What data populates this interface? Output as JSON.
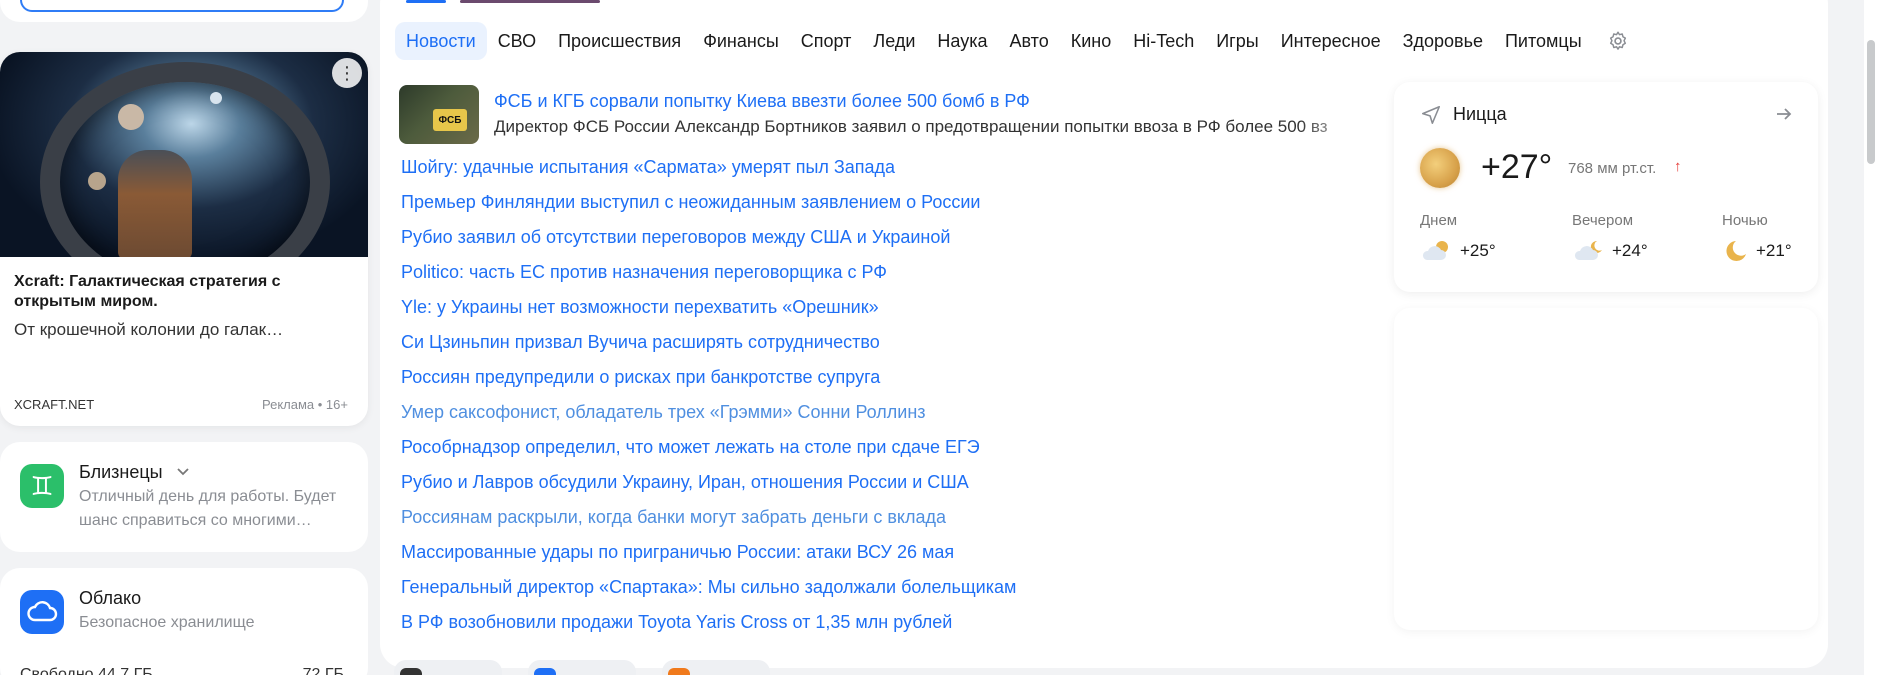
{
  "ad": {
    "menu_glyph": "⋮",
    "title": "Xcraft: Галактическая стратегия с открытым миром.",
    "description": "От крошечной колонии до галак…",
    "domain": "XCRAFT.NET",
    "label": "Реклама • 16+"
  },
  "horoscope": {
    "sign_glyph": "♊",
    "title": "Близнецы",
    "text_line1": "Отличный день для работы. Будет",
    "text_line2": "шанс справиться со многими…"
  },
  "cloud": {
    "title": "Облако",
    "subtitle": "Безопасное хранилище",
    "free": "Свободно 44,7 ГБ",
    "total": "72 ГБ"
  },
  "tabs": [
    {
      "label": "Новости",
      "active": true
    },
    {
      "label": "СВО"
    },
    {
      "label": "Происшествия"
    },
    {
      "label": "Финансы"
    },
    {
      "label": "Спорт"
    },
    {
      "label": "Леди"
    },
    {
      "label": "Наука"
    },
    {
      "label": "Авто"
    },
    {
      "label": "Кино"
    },
    {
      "label": "Hi-Tech"
    },
    {
      "label": "Игры"
    },
    {
      "label": "Интересное"
    },
    {
      "label": "Здоровье"
    },
    {
      "label": "Питомцы"
    }
  ],
  "feature": {
    "thumb_badge": "ФСБ",
    "title": "ФСБ и КГБ сорвали попытку Киева ввезти более 500 бомб в РФ",
    "lead": "Директор ФСБ России Александр Бортников заявил о предотвращении попытки ввоза в РФ более 500 вз"
  },
  "news": [
    {
      "title": "Шойгу: удачные испытания «Сармата» умерят пыл Запада"
    },
    {
      "title": "Премьер Финляндии выступил с неожиданным заявлением о России"
    },
    {
      "title": "Рубио заявил об отсутствии переговоров между США и Украиной"
    },
    {
      "title": "Politico: часть ЕС против назначения переговорщика с РФ"
    },
    {
      "title": "Yle: у Украины нет возможности перехватить «Орешник»"
    },
    {
      "title": "Си Цзиньпин призвал Вучича расширять сотрудничество"
    },
    {
      "title": "Россиян предупредили о рисках при банкротстве супруга"
    },
    {
      "title": "Умер саксофонист, обладатель трех «Грэмми» Сонни Роллинз",
      "visited": true
    },
    {
      "title": "Рособрнадзор определил, что может лежать на столе при сдаче ЕГЭ"
    },
    {
      "title": "Рубио и Лавров обсудили Украину, Иран, отношения России и США"
    },
    {
      "title": "Россиянам раскрыли, когда банки могут забрать деньги с вклада",
      "visited": true
    },
    {
      "title": "Массированные удары по приграничью России: атаки ВСУ 26 мая"
    },
    {
      "title": "Генеральный директор «Спартака»: Мы сильно задолжали болельщикам"
    },
    {
      "title": "В РФ возобновили продажи Toyota Yaris Cross от 1,35 млн рублей"
    }
  ],
  "weather": {
    "city": "Ницца",
    "temp": "+27°",
    "pressure": "768 мм рт.ст.",
    "pressure_trend": "↑",
    "parts": [
      {
        "label": "Днем",
        "temp": "+25°",
        "icon": "cloud-sun-icon"
      },
      {
        "label": "Вечером",
        "temp": "+24°",
        "icon": "cloud-moon-icon"
      },
      {
        "label": "Ночью",
        "temp": "+21°",
        "icon": "moon-icon"
      }
    ]
  },
  "colors": {
    "accent": "#1e6ff5",
    "link_visited": "#4f8fe0",
    "tab_active_bg": "#eaf2fe",
    "horoscope_green": "#2bbf6a",
    "pressure_up": "#e53935"
  }
}
